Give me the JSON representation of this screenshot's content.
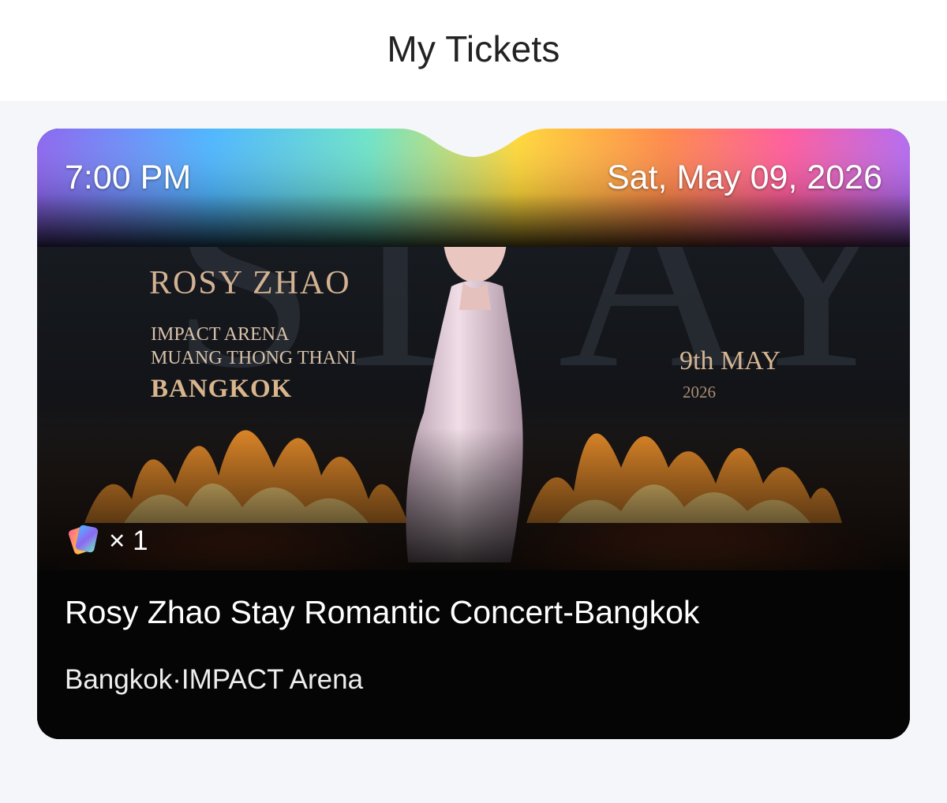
{
  "header": {
    "title": "My Tickets"
  },
  "ticket": {
    "time": "7:00 PM",
    "date": "Sat, May 09, 2026",
    "quantity": "× 1",
    "title": "Rosy Zhao Stay Romantic Concert-Bangkok",
    "venue": "Bangkok·IMPACT Arena",
    "poster": {
      "artist": "ROSY ZHAO",
      "venue_line1": "IMPACT ARENA",
      "venue_line2": "MUANG THONG THANI",
      "city": "BANGKOK",
      "date": "9th MAY",
      "year": "2026"
    }
  },
  "colors": {
    "page_background": "#f5f6f9",
    "header_background": "#ffffff",
    "card_background": "#050505",
    "gradient": [
      "#8e67f0",
      "#4fb7ff",
      "#6fe3c8",
      "#ffd83b",
      "#ff8a4c",
      "#ff5d9e",
      "#b46cf2"
    ]
  },
  "icons": {
    "ticket_quantity": "ticket-stack-icon"
  }
}
